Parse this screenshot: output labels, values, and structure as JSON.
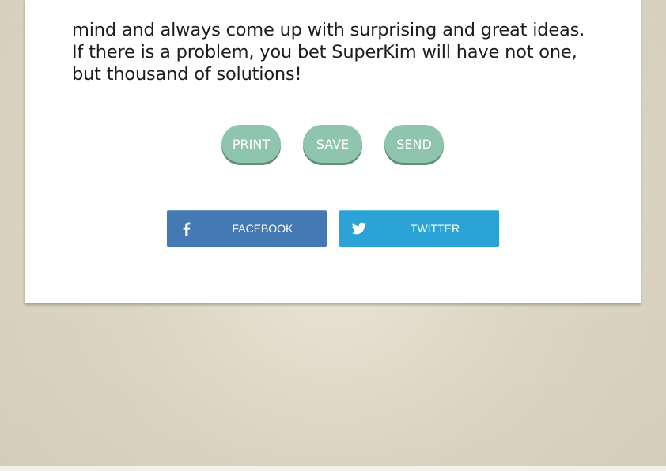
{
  "story": {
    "lines": [
      "mind and always come up with surprising and great ideas.",
      "If there is a problem, you bet SuperKim will have not one,",
      "but thousand of solutions!"
    ]
  },
  "actions": {
    "print_label": "PRINT",
    "save_label": "SAVE",
    "send_label": "SEND",
    "button_color": "#8fc4ae"
  },
  "social": {
    "facebook_label": "FACEBOOK",
    "twitter_label": "TWITTER",
    "facebook_icon": "facebook-f-icon",
    "twitter_icon": "twitter-bird-icon",
    "facebook_color": "#4579b4",
    "twitter_color": "#2ca3d6"
  }
}
